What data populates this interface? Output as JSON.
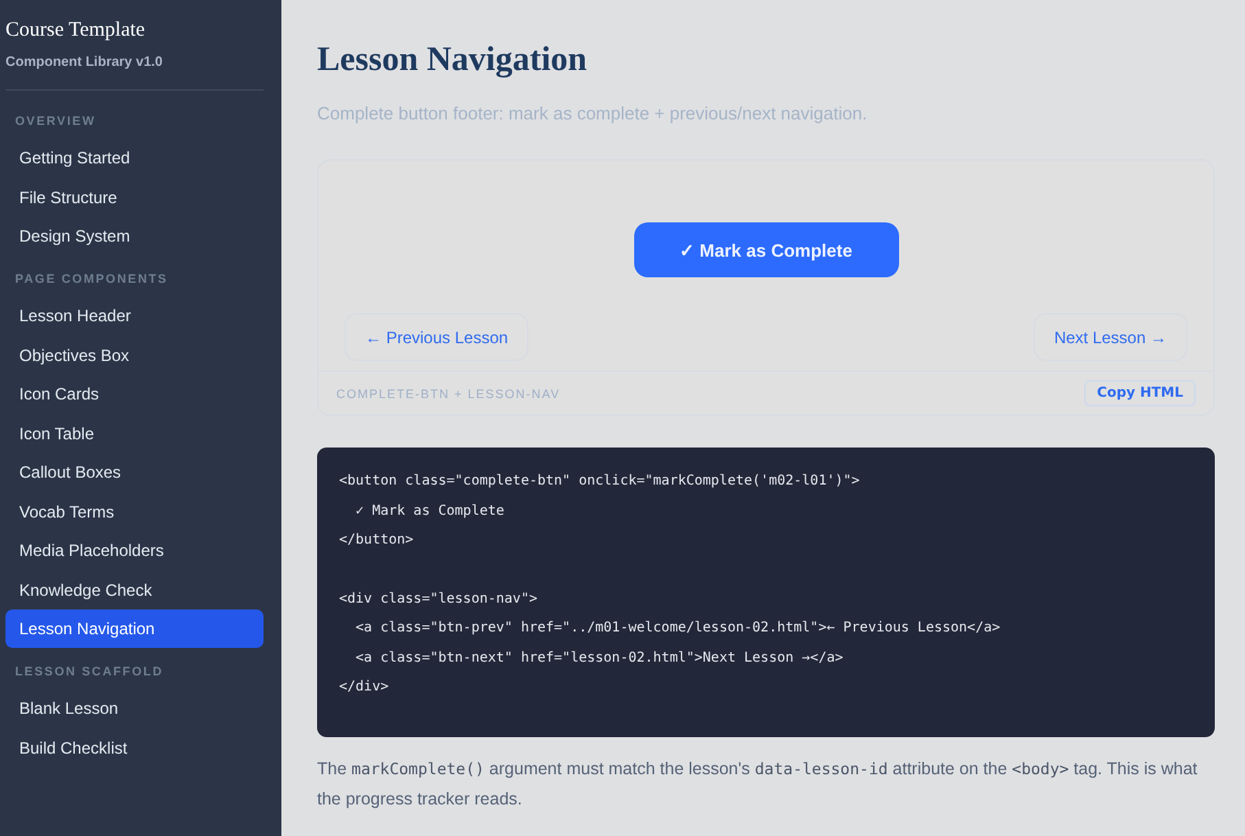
{
  "sidebar": {
    "title": "Course Template",
    "subtitle": "Component Library v1.0",
    "sections": [
      {
        "heading": "OVERVIEW",
        "items": [
          {
            "label": "Getting Started",
            "selected": false
          },
          {
            "label": "File Structure",
            "selected": false
          },
          {
            "label": "Design System",
            "selected": false
          }
        ]
      },
      {
        "heading": "PAGE COMPONENTS",
        "items": [
          {
            "label": "Lesson Header",
            "selected": false
          },
          {
            "label": "Objectives Box",
            "selected": false
          },
          {
            "label": "Icon Cards",
            "selected": false
          },
          {
            "label": "Icon Table",
            "selected": false
          },
          {
            "label": "Callout Boxes",
            "selected": false
          },
          {
            "label": "Vocab Terms",
            "selected": false
          },
          {
            "label": "Media Placeholders",
            "selected": false
          },
          {
            "label": "Knowledge Check",
            "selected": false
          },
          {
            "label": "Lesson Navigation",
            "selected": true
          }
        ]
      },
      {
        "heading": "LESSON SCAFFOLD",
        "items": [
          {
            "label": "Blank Lesson",
            "selected": false
          },
          {
            "label": "Build Checklist",
            "selected": false
          }
        ]
      }
    ]
  },
  "main": {
    "title": "Lesson Navigation",
    "subtitle": "Complete button footer: mark as complete + previous/next navigation.",
    "preview": {
      "complete_button": "✓ Mark as Complete",
      "prev_button": "← Previous Lesson",
      "next_button": "Next Lesson →",
      "footer_label": "COMPLETE-BTN + LESSON-NAV",
      "copy_button": "Copy HTML"
    },
    "code_blocks": [
      [
        "<button class=\"complete-btn\" onclick=\"markComplete('m02-l01')\">",
        "  ✓ Mark as Complete",
        "</button>"
      ],
      [
        "<div class=\"lesson-nav\">",
        "  <a class=\"btn-prev\" href=\"../m01-welcome/lesson-02.html\">← Previous Lesson</a>",
        "  <a class=\"btn-next\" href=\"lesson-02.html\">Next Lesson →</a>",
        "</div>"
      ]
    ],
    "note": [
      {
        "kind": "text",
        "text": "The "
      },
      {
        "kind": "code",
        "text": "markComplete()"
      },
      {
        "kind": "text",
        "text": " argument must match the lesson's "
      },
      {
        "kind": "code",
        "text": "data-lesson-id"
      },
      {
        "kind": "text",
        "text": " attribute on the "
      },
      {
        "kind": "code",
        "text": "<body>"
      },
      {
        "kind": "text",
        "text": " tag. This is what the progress tracker reads."
      }
    ]
  }
}
